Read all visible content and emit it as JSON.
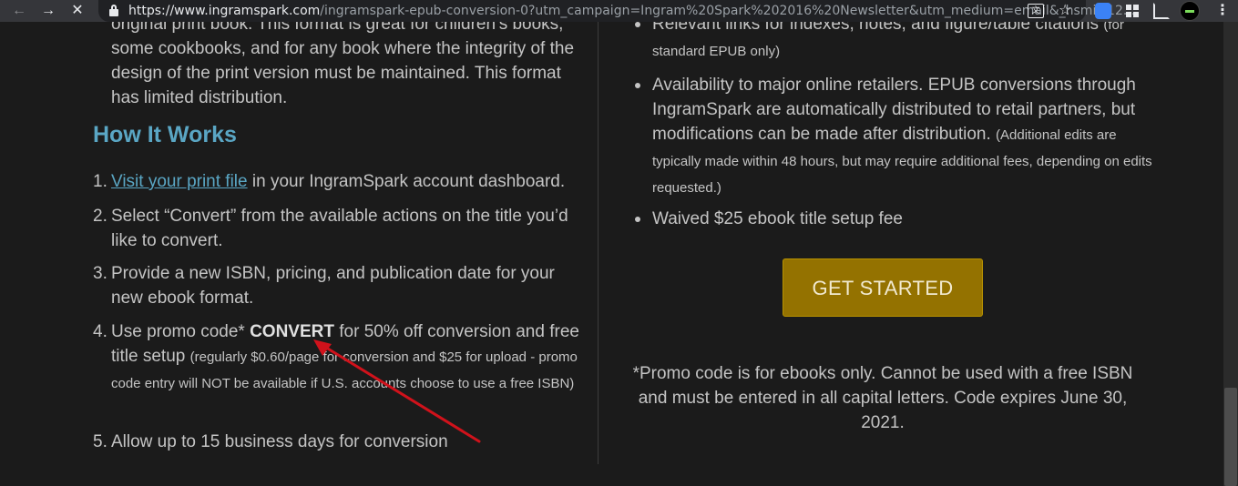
{
  "browser": {
    "url_host": "https://www.ingramspark.com",
    "url_path": "/ingramspark-epub-conversion-0?utm_campaign=Ingram%20Spark%202016%20Newsletter&utm_medium=email&_hsmi=12...",
    "icons": [
      "back-icon",
      "forward-icon",
      "stop-icon",
      "lock-icon",
      "translate-icon",
      "star-icon",
      "extension-icon",
      "apps-grid-icon",
      "crop-icon",
      "avatar",
      "menu-icon"
    ]
  },
  "left": {
    "intro_text": "original print book. This format is great for children's books, some cookbooks, and for any book where the integrity of the design of the print version must be maintained. This format has limited distribution.",
    "heading": "How It Works",
    "steps": [
      {
        "num": "1.",
        "link": "Visit your print file",
        "text": " in your IngramSpark account dashboard."
      },
      {
        "num": "2.",
        "text": "Select “Convert” from the available actions on the title you’d like to convert."
      },
      {
        "num": "3.",
        "text": "Provide a new ISBN, pricing, and publication date for your new ebook format."
      },
      {
        "num": "4.",
        "before": "Use promo code* ",
        "code": "CONVERT",
        "after": " for 50% off conversion and free title setup ",
        "note": "(regularly $0.60/page for conversion and $25 for upload - promo code entry will NOT be available if U.S. accounts choose to use a free ISBN)"
      },
      {
        "num": "5.",
        "text": "Allow up to 15 business days for conversion"
      }
    ]
  },
  "right": {
    "bullets": [
      {
        "text": "Relevant links for indexes, notes, and figure/table citations ",
        "note": "(for standard EPUB only)"
      },
      {
        "text": "Availability to major online retailers. EPUB conversions through IngramSpark are automatically distributed to retail partners, but modifications can be made after distribution. ",
        "note": "(Additional edits are typically made within 48 hours, but may require additional fees, depending on edits requested.)"
      },
      {
        "text": "Waived $25 ebook title setup fee"
      }
    ],
    "cta_label": "GET STARTED",
    "promo_note": "*Promo code is for ebooks only. Cannot be used with a free ISBN and must be entered in all capital letters. Code expires June 30, 2021."
  },
  "colors": {
    "background": "#1b1b1b",
    "link": "#5aa6c4",
    "cta": "#947200",
    "annotation_arrow": "#d0121b"
  }
}
